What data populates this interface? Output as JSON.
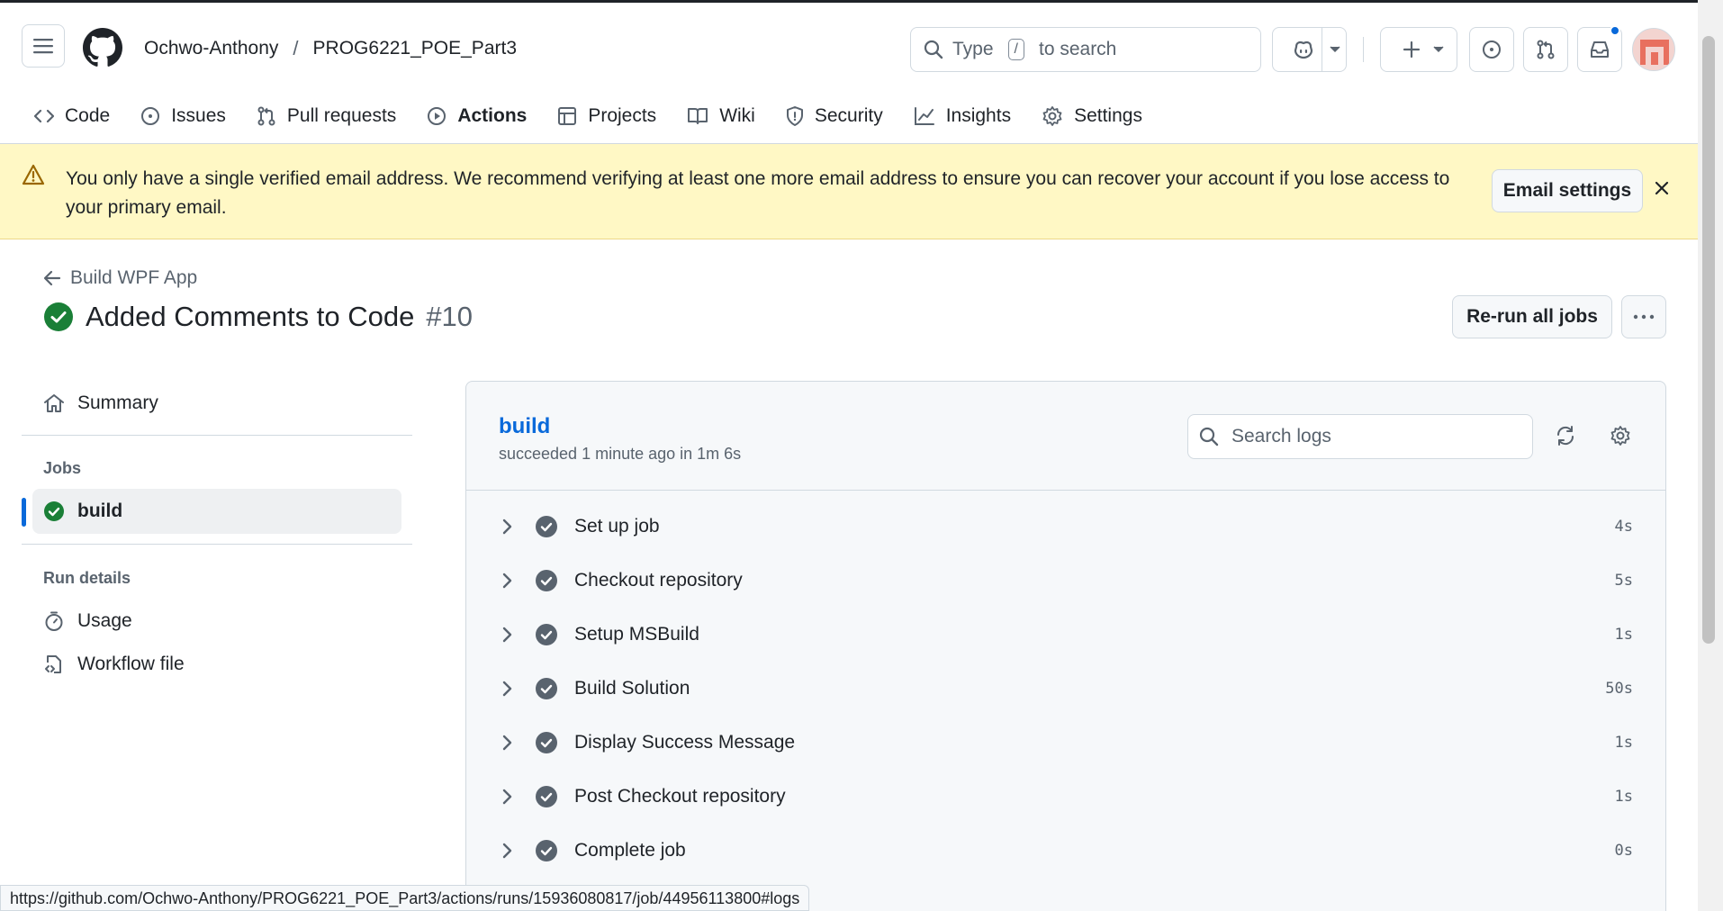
{
  "header": {
    "owner": "Ochwo-Anthony",
    "separator": "/",
    "repo": "PROG6221_POE_Part3",
    "search_prefix": "Type",
    "search_key": "/",
    "search_suffix": "to search"
  },
  "tabs": [
    {
      "label": "Code",
      "icon": "code-icon"
    },
    {
      "label": "Issues",
      "icon": "issue-icon"
    },
    {
      "label": "Pull requests",
      "icon": "pull-request-icon"
    },
    {
      "label": "Actions",
      "icon": "play-icon",
      "active": true
    },
    {
      "label": "Projects",
      "icon": "table-icon"
    },
    {
      "label": "Wiki",
      "icon": "book-icon"
    },
    {
      "label": "Security",
      "icon": "shield-icon"
    },
    {
      "label": "Insights",
      "icon": "graph-icon"
    },
    {
      "label": "Settings",
      "icon": "gear-icon"
    }
  ],
  "banner": {
    "message": "You only have a single verified email address. We recommend verifying at least one more email address to ensure you can recover your account if you lose access to your primary email.",
    "button": "Email settings"
  },
  "run": {
    "workflow": "Build WPF App",
    "title": "Added Comments to Code",
    "number": "#10",
    "rerun_label": "Re-run all jobs",
    "status": "success"
  },
  "sidebar": {
    "summary": "Summary",
    "jobs_heading": "Jobs",
    "job": "build",
    "run_details_heading": "Run details",
    "usage": "Usage",
    "workflow_file": "Workflow file"
  },
  "job": {
    "name": "build",
    "meta": "succeeded 1 minute ago in 1m 6s",
    "search_placeholder": "Search logs",
    "steps": [
      {
        "label": "Set up job",
        "duration": "4s"
      },
      {
        "label": "Checkout repository",
        "duration": "5s"
      },
      {
        "label": "Setup MSBuild",
        "duration": "1s"
      },
      {
        "label": "Build Solution",
        "duration": "50s"
      },
      {
        "label": "Display Success Message",
        "duration": "1s"
      },
      {
        "label": "Post Checkout repository",
        "duration": "1s"
      },
      {
        "label": "Complete job",
        "duration": "0s"
      }
    ]
  },
  "status_bar": {
    "url": "https://github.com/Ochwo-Anthony/PROG6221_POE_Part3/actions/runs/15936080817/job/44956113800#logs"
  },
  "colors": {
    "success": "#1a7f37",
    "link": "#0969da",
    "active_tab_underline": "#fd8c73",
    "banner_bg": "#fff8c5",
    "step_check": "#59636e"
  }
}
